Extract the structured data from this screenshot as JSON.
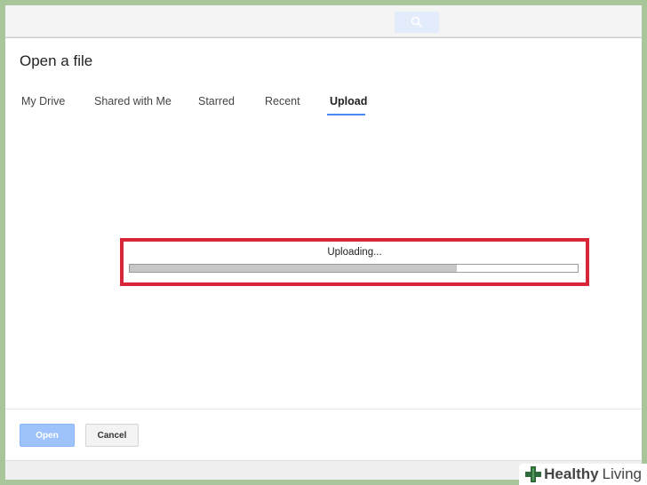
{
  "dialog": {
    "title": "Open a file"
  },
  "tabs": [
    {
      "label": "My Drive",
      "active": false
    },
    {
      "label": "Shared with Me",
      "active": false
    },
    {
      "label": "Starred",
      "active": false
    },
    {
      "label": "Recent",
      "active": false
    },
    {
      "label": "Upload",
      "active": true
    }
  ],
  "upload": {
    "status_text": "Uploading...",
    "progress_percent": 73
  },
  "footer": {
    "open_label": "Open",
    "cancel_label": "Cancel"
  },
  "watermark": {
    "brand_bold": "Healthy",
    "brand_rest": "Living"
  },
  "colors": {
    "accent_blue": "#4a8af4",
    "highlight_red": "#d72638",
    "frame_green": "#a9c59a",
    "watermark_green": "#2e6b3a"
  },
  "icons": {
    "search": "search-icon",
    "logo": "healthy-living-cross-icon"
  }
}
